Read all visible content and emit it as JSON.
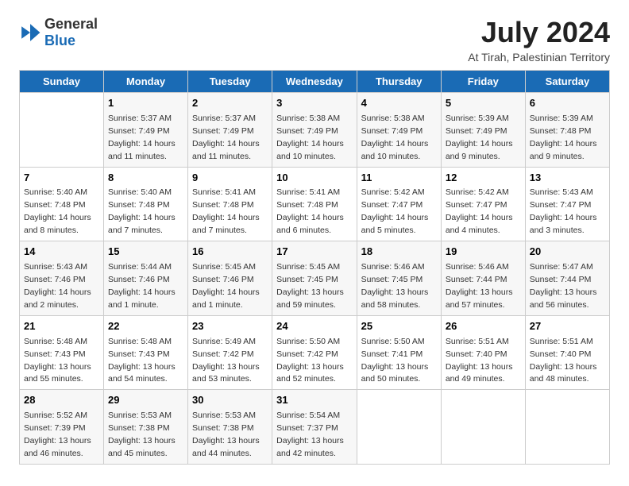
{
  "logo": {
    "general": "General",
    "blue": "Blue"
  },
  "title": "July 2024",
  "subtitle": "At Tirah, Palestinian Territory",
  "days_header": [
    "Sunday",
    "Monday",
    "Tuesday",
    "Wednesday",
    "Thursday",
    "Friday",
    "Saturday"
  ],
  "weeks": [
    [
      {
        "day": "",
        "sunrise": "",
        "sunset": "",
        "daylight": ""
      },
      {
        "day": "1",
        "sunrise": "Sunrise: 5:37 AM",
        "sunset": "Sunset: 7:49 PM",
        "daylight": "Daylight: 14 hours and 11 minutes."
      },
      {
        "day": "2",
        "sunrise": "Sunrise: 5:37 AM",
        "sunset": "Sunset: 7:49 PM",
        "daylight": "Daylight: 14 hours and 11 minutes."
      },
      {
        "day": "3",
        "sunrise": "Sunrise: 5:38 AM",
        "sunset": "Sunset: 7:49 PM",
        "daylight": "Daylight: 14 hours and 10 minutes."
      },
      {
        "day": "4",
        "sunrise": "Sunrise: 5:38 AM",
        "sunset": "Sunset: 7:49 PM",
        "daylight": "Daylight: 14 hours and 10 minutes."
      },
      {
        "day": "5",
        "sunrise": "Sunrise: 5:39 AM",
        "sunset": "Sunset: 7:49 PM",
        "daylight": "Daylight: 14 hours and 9 minutes."
      },
      {
        "day": "6",
        "sunrise": "Sunrise: 5:39 AM",
        "sunset": "Sunset: 7:48 PM",
        "daylight": "Daylight: 14 hours and 9 minutes."
      }
    ],
    [
      {
        "day": "7",
        "sunrise": "Sunrise: 5:40 AM",
        "sunset": "Sunset: 7:48 PM",
        "daylight": "Daylight: 14 hours and 8 minutes."
      },
      {
        "day": "8",
        "sunrise": "Sunrise: 5:40 AM",
        "sunset": "Sunset: 7:48 PM",
        "daylight": "Daylight: 14 hours and 7 minutes."
      },
      {
        "day": "9",
        "sunrise": "Sunrise: 5:41 AM",
        "sunset": "Sunset: 7:48 PM",
        "daylight": "Daylight: 14 hours and 7 minutes."
      },
      {
        "day": "10",
        "sunrise": "Sunrise: 5:41 AM",
        "sunset": "Sunset: 7:48 PM",
        "daylight": "Daylight: 14 hours and 6 minutes."
      },
      {
        "day": "11",
        "sunrise": "Sunrise: 5:42 AM",
        "sunset": "Sunset: 7:47 PM",
        "daylight": "Daylight: 14 hours and 5 minutes."
      },
      {
        "day": "12",
        "sunrise": "Sunrise: 5:42 AM",
        "sunset": "Sunset: 7:47 PM",
        "daylight": "Daylight: 14 hours and 4 minutes."
      },
      {
        "day": "13",
        "sunrise": "Sunrise: 5:43 AM",
        "sunset": "Sunset: 7:47 PM",
        "daylight": "Daylight: 14 hours and 3 minutes."
      }
    ],
    [
      {
        "day": "14",
        "sunrise": "Sunrise: 5:43 AM",
        "sunset": "Sunset: 7:46 PM",
        "daylight": "Daylight: 14 hours and 2 minutes."
      },
      {
        "day": "15",
        "sunrise": "Sunrise: 5:44 AM",
        "sunset": "Sunset: 7:46 PM",
        "daylight": "Daylight: 14 hours and 1 minute."
      },
      {
        "day": "16",
        "sunrise": "Sunrise: 5:45 AM",
        "sunset": "Sunset: 7:46 PM",
        "daylight": "Daylight: 14 hours and 1 minute."
      },
      {
        "day": "17",
        "sunrise": "Sunrise: 5:45 AM",
        "sunset": "Sunset: 7:45 PM",
        "daylight": "Daylight: 13 hours and 59 minutes."
      },
      {
        "day": "18",
        "sunrise": "Sunrise: 5:46 AM",
        "sunset": "Sunset: 7:45 PM",
        "daylight": "Daylight: 13 hours and 58 minutes."
      },
      {
        "day": "19",
        "sunrise": "Sunrise: 5:46 AM",
        "sunset": "Sunset: 7:44 PM",
        "daylight": "Daylight: 13 hours and 57 minutes."
      },
      {
        "day": "20",
        "sunrise": "Sunrise: 5:47 AM",
        "sunset": "Sunset: 7:44 PM",
        "daylight": "Daylight: 13 hours and 56 minutes."
      }
    ],
    [
      {
        "day": "21",
        "sunrise": "Sunrise: 5:48 AM",
        "sunset": "Sunset: 7:43 PM",
        "daylight": "Daylight: 13 hours and 55 minutes."
      },
      {
        "day": "22",
        "sunrise": "Sunrise: 5:48 AM",
        "sunset": "Sunset: 7:43 PM",
        "daylight": "Daylight: 13 hours and 54 minutes."
      },
      {
        "day": "23",
        "sunrise": "Sunrise: 5:49 AM",
        "sunset": "Sunset: 7:42 PM",
        "daylight": "Daylight: 13 hours and 53 minutes."
      },
      {
        "day": "24",
        "sunrise": "Sunrise: 5:50 AM",
        "sunset": "Sunset: 7:42 PM",
        "daylight": "Daylight: 13 hours and 52 minutes."
      },
      {
        "day": "25",
        "sunrise": "Sunrise: 5:50 AM",
        "sunset": "Sunset: 7:41 PM",
        "daylight": "Daylight: 13 hours and 50 minutes."
      },
      {
        "day": "26",
        "sunrise": "Sunrise: 5:51 AM",
        "sunset": "Sunset: 7:40 PM",
        "daylight": "Daylight: 13 hours and 49 minutes."
      },
      {
        "day": "27",
        "sunrise": "Sunrise: 5:51 AM",
        "sunset": "Sunset: 7:40 PM",
        "daylight": "Daylight: 13 hours and 48 minutes."
      }
    ],
    [
      {
        "day": "28",
        "sunrise": "Sunrise: 5:52 AM",
        "sunset": "Sunset: 7:39 PM",
        "daylight": "Daylight: 13 hours and 46 minutes."
      },
      {
        "day": "29",
        "sunrise": "Sunrise: 5:53 AM",
        "sunset": "Sunset: 7:38 PM",
        "daylight": "Daylight: 13 hours and 45 minutes."
      },
      {
        "day": "30",
        "sunrise": "Sunrise: 5:53 AM",
        "sunset": "Sunset: 7:38 PM",
        "daylight": "Daylight: 13 hours and 44 minutes."
      },
      {
        "day": "31",
        "sunrise": "Sunrise: 5:54 AM",
        "sunset": "Sunset: 7:37 PM",
        "daylight": "Daylight: 13 hours and 42 minutes."
      },
      {
        "day": "",
        "sunrise": "",
        "sunset": "",
        "daylight": ""
      },
      {
        "day": "",
        "sunrise": "",
        "sunset": "",
        "daylight": ""
      },
      {
        "day": "",
        "sunrise": "",
        "sunset": "",
        "daylight": ""
      }
    ]
  ]
}
